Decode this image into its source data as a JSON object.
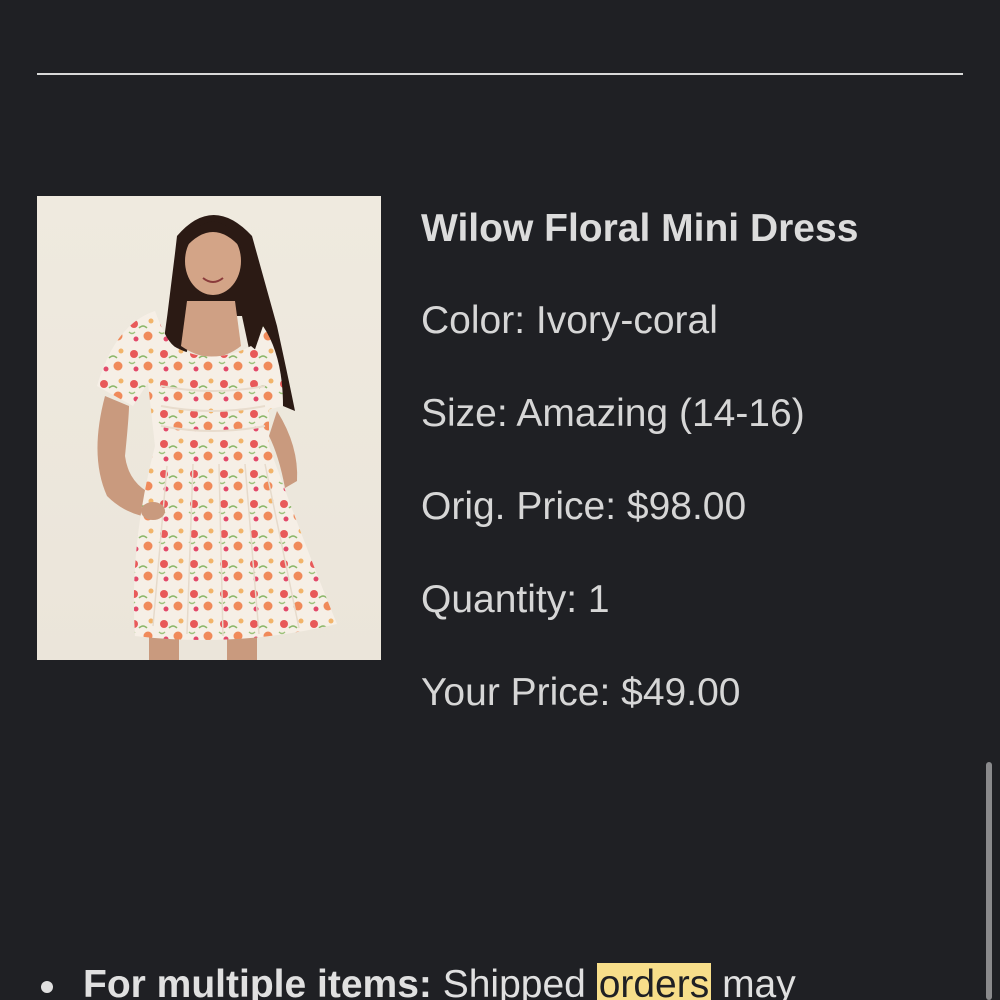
{
  "product": {
    "name": "Wilow Floral Mini Dress",
    "color": "Color: Ivory-coral",
    "size": "Size: Amazing (14-16)",
    "orig_price": "Orig. Price: $98.00",
    "quantity": "Quantity: 1",
    "your_price": "Your Price: $49.00",
    "image_icon": "product-photo"
  },
  "notes": {
    "label": "For multiple items:",
    "text_before": " Shipped ",
    "highlight": "orders",
    "text_after": " may"
  },
  "colors": {
    "background": "#1f2024",
    "text": "#d9d9d9",
    "highlight": "#f7de8a"
  }
}
